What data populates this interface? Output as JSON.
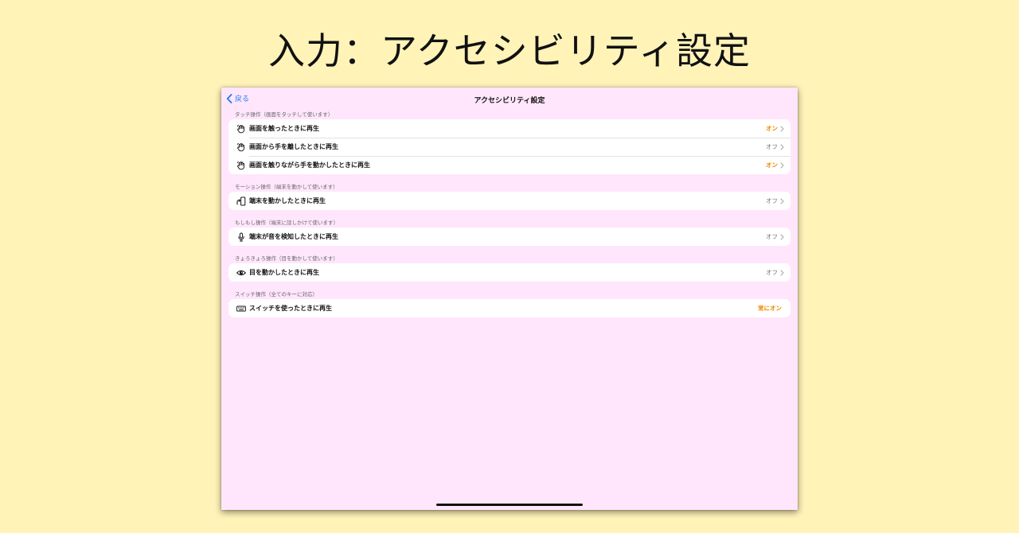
{
  "page_title": "入力：アクセシビリティ設定",
  "nav": {
    "back_label": "戻る",
    "title": "アクセシビリティ設定"
  },
  "sections": [
    {
      "header": "タッチ操作（画面をタッチして使います）",
      "rows": [
        {
          "icon": "hand-icon",
          "label": "画面を触ったときに再生",
          "value": "オン",
          "state": "on"
        },
        {
          "icon": "hand-icon",
          "label": "画面から手を離したときに再生",
          "value": "オフ",
          "state": "off"
        },
        {
          "icon": "hand-icon",
          "label": "画面を触りながら手を動かしたときに再生",
          "value": "オン",
          "state": "on"
        }
      ]
    },
    {
      "header": "モーション操作（端末を動かして使います）",
      "rows": [
        {
          "icon": "device-motion-icon",
          "label": "端末を動かしたときに再生",
          "value": "オフ",
          "state": "off"
        }
      ]
    },
    {
      "header": "もしもし操作（端末に話しかけて使います）",
      "rows": [
        {
          "icon": "microphone-icon",
          "label": "端末が音を検知したときに再生",
          "value": "オフ",
          "state": "off"
        }
      ]
    },
    {
      "header": "きょろきょろ操作（目を動かして使います）",
      "rows": [
        {
          "icon": "eye-icon",
          "label": "目を動かしたときに再生",
          "value": "オフ",
          "state": "off"
        }
      ]
    },
    {
      "header": "スイッチ操作（全てのキーに対応）",
      "rows": [
        {
          "icon": "keyboard-icon",
          "label": "スイッチを使ったときに再生",
          "value": "常にオン",
          "state": "on"
        }
      ]
    }
  ],
  "colors": {
    "page_bg": "#fff3b8",
    "screen_bg": "#ffe6fc",
    "accent_on": "#ef8a00",
    "link": "#1a7cf0"
  }
}
